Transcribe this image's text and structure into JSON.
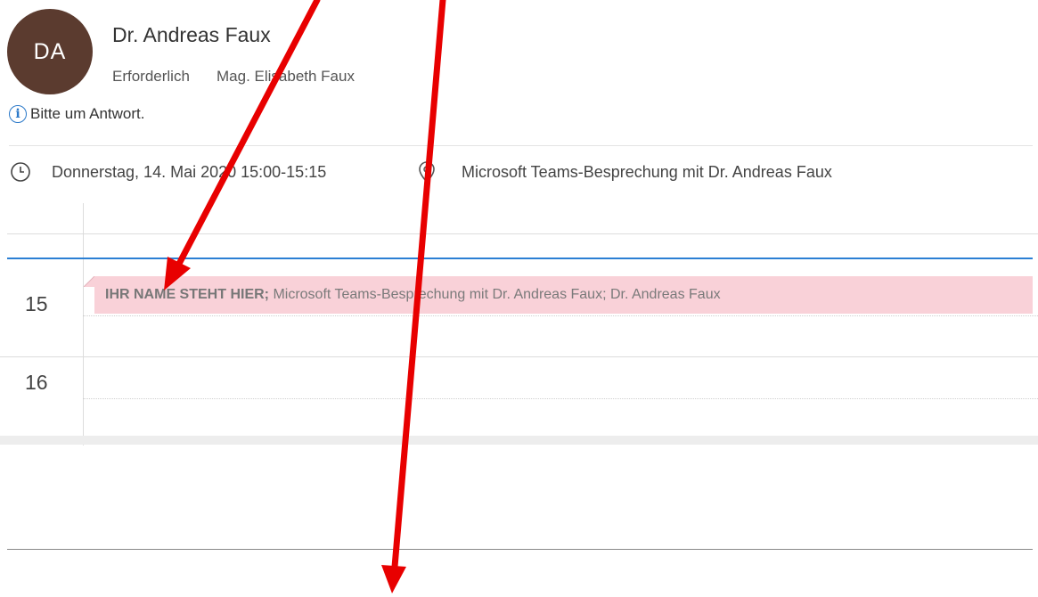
{
  "header": {
    "avatar_initials": "DA",
    "sender": "Dr. Andreas Faux",
    "required_label": "Erforderlich",
    "required_attendee": "Mag. Elisabeth Faux",
    "info_message": "Bitte um Antwort."
  },
  "meeting": {
    "when": "Donnerstag, 14. Mai 2020 15:00-15:15",
    "location": "Microsoft Teams-Besprechung mit Dr. Andreas Faux"
  },
  "calendar": {
    "hours": [
      "15",
      "16"
    ],
    "event": {
      "name": "IHR NAME STEHT HIER;",
      "rest": " Microsoft Teams-Besprechung mit Dr. Andreas Faux; Dr. Andreas Faux"
    }
  },
  "colors": {
    "avatar": "#5b3b2f",
    "accent": "#2b7fd4",
    "event_bg": "#f9d1d8",
    "annotation": "#e80000"
  },
  "icons": [
    "info-icon",
    "clock-icon",
    "location-pin-icon",
    "arrow-annotation"
  ]
}
